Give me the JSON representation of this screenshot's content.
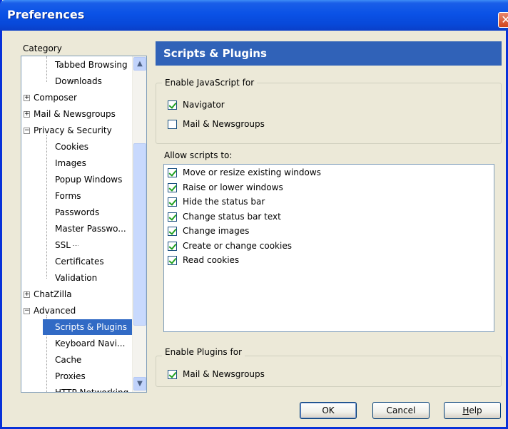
{
  "window": {
    "title": "Preferences",
    "close_glyph": "✕"
  },
  "category_label": "Category",
  "tree": [
    {
      "label": "Tabbed Browsing",
      "level": 1,
      "expander": ""
    },
    {
      "label": "Downloads",
      "level": 1,
      "expander": ""
    },
    {
      "label": "Composer",
      "level": 0,
      "expander": "+"
    },
    {
      "label": "Mail & Newsgroups",
      "level": 0,
      "expander": "+"
    },
    {
      "label": "Privacy & Security",
      "level": 0,
      "expander": "−"
    },
    {
      "label": "Cookies",
      "level": 1,
      "expander": ""
    },
    {
      "label": "Images",
      "level": 1,
      "expander": ""
    },
    {
      "label": "Popup Windows",
      "level": 1,
      "expander": ""
    },
    {
      "label": "Forms",
      "level": 1,
      "expander": ""
    },
    {
      "label": "Passwords",
      "level": 1,
      "expander": ""
    },
    {
      "label": "Master Passwo...",
      "level": 1,
      "expander": ""
    },
    {
      "label": "SSL",
      "level": 1,
      "expander": ""
    },
    {
      "label": "Certificates",
      "level": 1,
      "expander": ""
    },
    {
      "label": "Validation",
      "level": 1,
      "expander": ""
    },
    {
      "label": "ChatZilla",
      "level": 0,
      "expander": "+"
    },
    {
      "label": "Advanced",
      "level": 0,
      "expander": "−"
    },
    {
      "label": "Scripts & Plugins",
      "level": 1,
      "expander": "",
      "selected": true
    },
    {
      "label": "Keyboard Navi...",
      "level": 1,
      "expander": ""
    },
    {
      "label": "Cache",
      "level": 1,
      "expander": ""
    },
    {
      "label": "Proxies",
      "level": 1,
      "expander": ""
    },
    {
      "label": "HTTP Networking",
      "level": 1,
      "expander": ""
    }
  ],
  "scroll": {
    "up_glyph": "▲",
    "down_glyph": "▼"
  },
  "panel": {
    "title": "Scripts & Plugins",
    "js_group": {
      "legend": "Enable JavaScript for",
      "items": [
        {
          "label": "Navigator",
          "checked": true
        },
        {
          "label": "Mail & Newsgroups",
          "checked": false
        }
      ]
    },
    "allow_label": "Allow scripts to:",
    "allow_items": [
      {
        "label": "Move or resize existing windows",
        "checked": true
      },
      {
        "label": "Raise or lower windows",
        "checked": true
      },
      {
        "label": "Hide the status bar",
        "checked": true
      },
      {
        "label": "Change status bar text",
        "checked": true
      },
      {
        "label": "Change images",
        "checked": true
      },
      {
        "label": "Create or change cookies",
        "checked": true
      },
      {
        "label": "Read cookies",
        "checked": true
      }
    ],
    "plugins_group": {
      "legend": "Enable Plugins for",
      "items": [
        {
          "label": "Mail & Newsgroups",
          "checked": true
        }
      ]
    }
  },
  "buttons": {
    "ok": "OK",
    "cancel": "Cancel",
    "help_first": "H",
    "help_rest": "elp"
  }
}
